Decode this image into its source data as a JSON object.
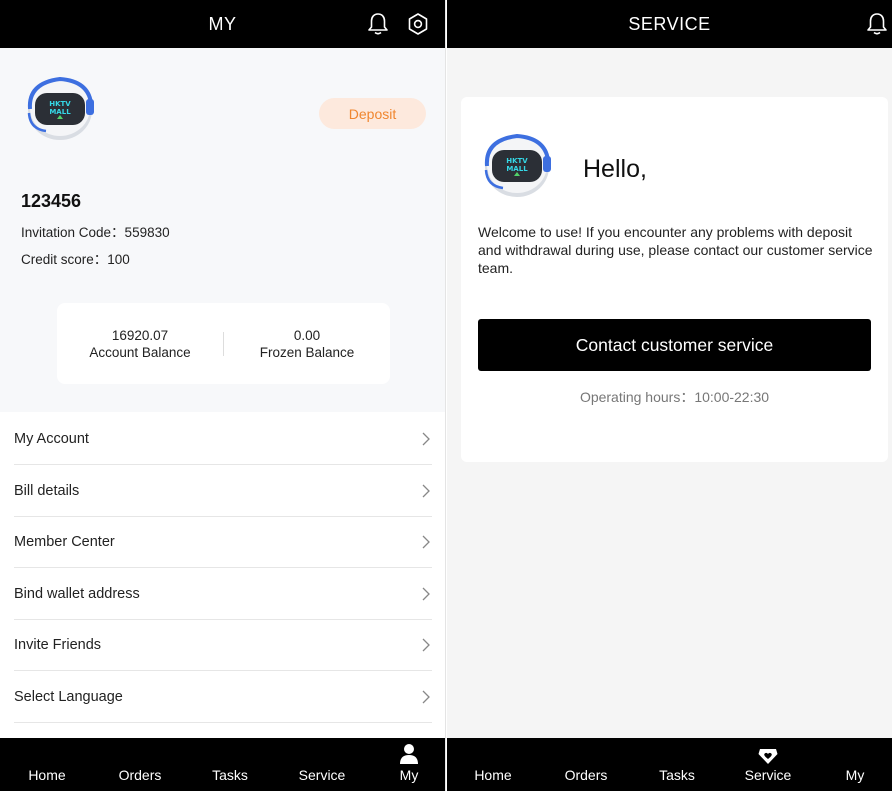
{
  "my_screen": {
    "header": {
      "title": "MY",
      "bell_icon": "bell-icon",
      "settings_icon": "hexagon-settings-icon"
    },
    "avatar": {
      "icon": "robot-avatar-icon",
      "text_line1": "HKTV",
      "text_line2": "MALL"
    },
    "deposit_label": "Deposit",
    "username": "123456",
    "invitation": "Invitation Code：559830",
    "credit": "Credit score：100",
    "balance": {
      "account_value": "16920.07",
      "account_label": "Account Balance",
      "frozen_value": "0.00",
      "frozen_label": "Frozen Balance"
    },
    "menu": [
      {
        "label": "My Account"
      },
      {
        "label": "Bill details"
      },
      {
        "label": "Member Center"
      },
      {
        "label": "Bind wallet address"
      },
      {
        "label": "Invite Friends"
      },
      {
        "label": "Select Language"
      }
    ],
    "tabbar": {
      "tabs": [
        {
          "label": "Home"
        },
        {
          "label": "Orders"
        },
        {
          "label": "Tasks"
        },
        {
          "label": "Service"
        },
        {
          "label": "My",
          "active": true
        }
      ]
    }
  },
  "service_screen": {
    "header": {
      "title": "SERVICE",
      "bell_icon": "bell-icon"
    },
    "avatar": {
      "icon": "robot-avatar-icon",
      "text_line1": "HKTV",
      "text_line2": "MALL"
    },
    "hello": "Hello,",
    "welcome": "Welcome to use! If you encounter any problems with deposit and withdrawal during use, please contact our customer service team.",
    "contact_button": "Contact customer service",
    "hours": "Operating hours：10:00-22:30",
    "tabbar": {
      "tabs": [
        {
          "label": "Home"
        },
        {
          "label": "Orders"
        },
        {
          "label": "Tasks"
        },
        {
          "label": "Service",
          "active": true
        },
        {
          "label": "My"
        }
      ]
    }
  },
  "colors": {
    "accent_orange": "#f0862f",
    "deposit_bg": "#fde9dd",
    "bar_black": "#000000"
  }
}
